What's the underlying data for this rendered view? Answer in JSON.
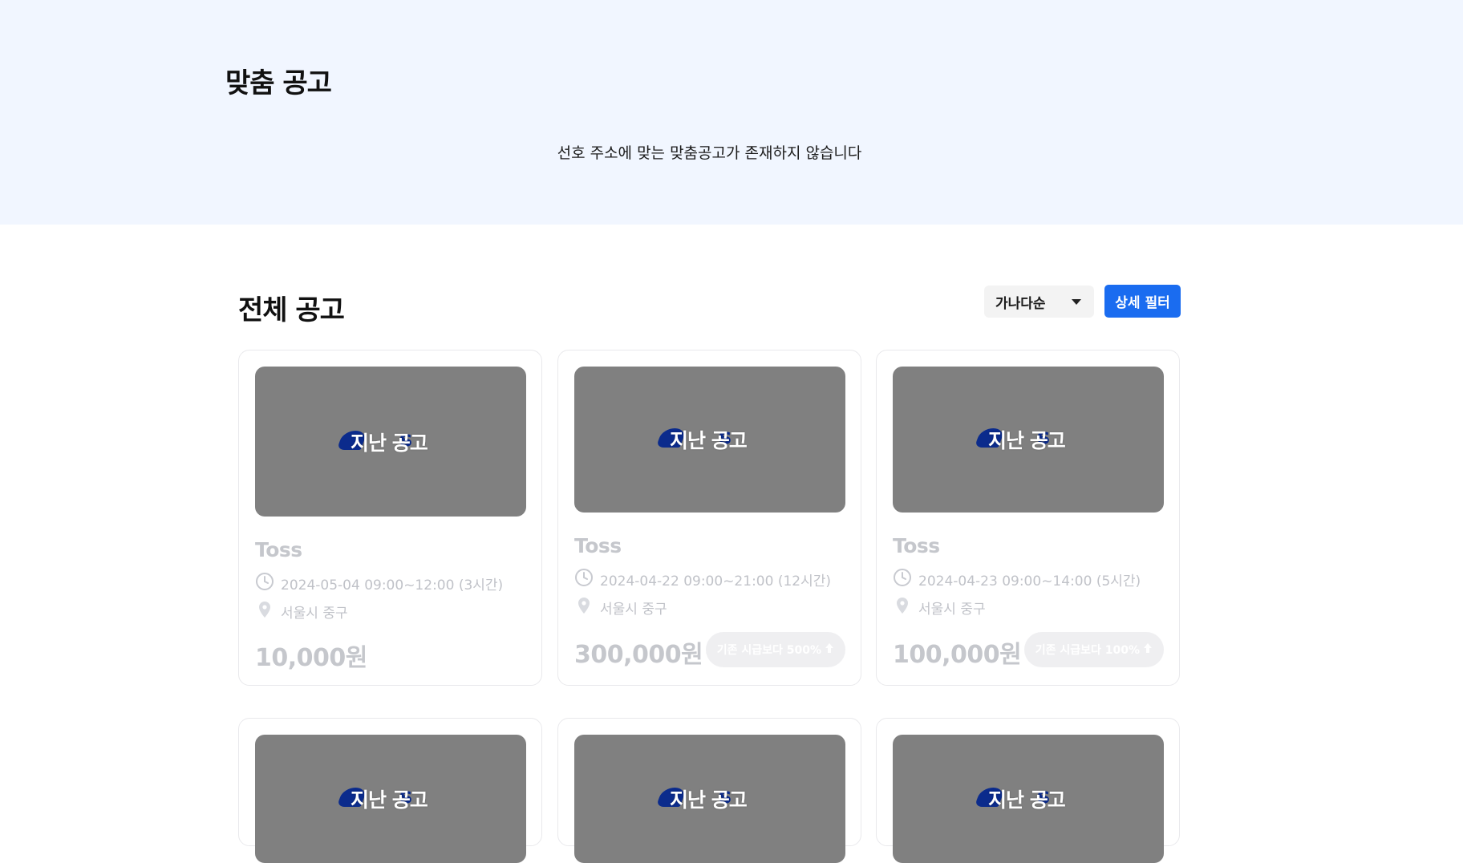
{
  "recommended": {
    "title": "맞춤 공고",
    "empty_message": "선호 주소에 맞는 맞춤공고가 존재하지 않습니다"
  },
  "all_jobs": {
    "title": "전체 공고",
    "sort": {
      "selected": "가나다순",
      "icon": "chevron-down-icon"
    },
    "filter_button": "상세 필터"
  },
  "thumbnail_label": "지난 공고",
  "thumbnail_logo_letter": "s",
  "cards": [
    {
      "company": "Toss",
      "schedule": "2024-05-04 09:00~12:00 (3시간)",
      "location": "서울시 중구",
      "price": "10,000원",
      "badge": ""
    },
    {
      "company": "Toss",
      "schedule": "2024-04-22 09:00~21:00 (12시간)",
      "location": "서울시 중구",
      "price": "300,000원",
      "badge": "기존 시급보다 500%"
    },
    {
      "company": "Toss",
      "schedule": "2024-04-23 09:00~14:00 (5시간)",
      "location": "서울시 중구",
      "price": "100,000원",
      "badge": "기존 시급보다 100%"
    },
    {
      "company": "",
      "schedule": "",
      "location": "",
      "price": "",
      "badge": ""
    },
    {
      "company": "",
      "schedule": "",
      "location": "",
      "price": "",
      "badge": ""
    },
    {
      "company": "",
      "schedule": "",
      "location": "",
      "price": "",
      "badge": ""
    }
  ],
  "colors": {
    "hero_bg": "#f1f6ff",
    "primary": "#1a6cf0",
    "thumb_bg": "#808080",
    "logo_blue": "#0b2b8c",
    "muted_text": "#c5c7cc"
  }
}
